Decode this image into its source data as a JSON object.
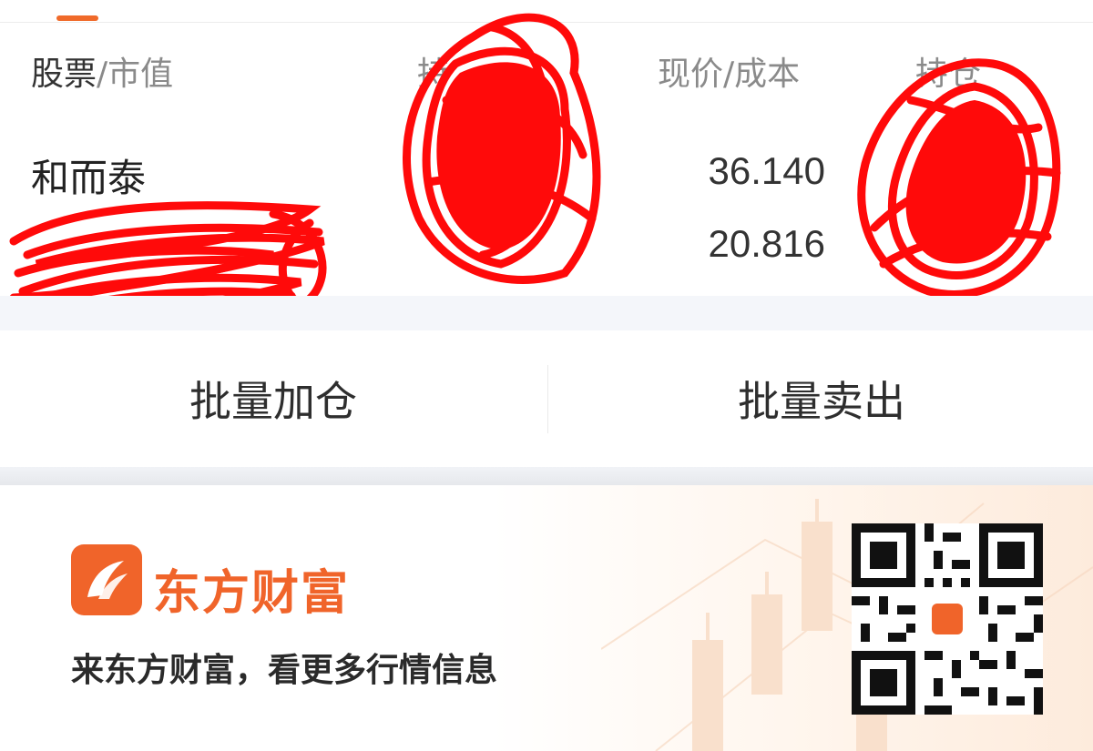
{
  "holdings": {
    "headers": {
      "stock": "股票",
      "market_value": "/市值",
      "holding_partial": "持",
      "price_cost": "现价/成本",
      "position_partial": "持仓"
    },
    "rows": [
      {
        "name": "和而泰",
        "price": "36.140",
        "cost": "20.816"
      }
    ]
  },
  "actions": {
    "add": "批量加仓",
    "sell": "批量卖出"
  },
  "banner": {
    "brand": "东方财富",
    "slogan": "来东方财富，看更多行情信息"
  },
  "colors": {
    "brand_orange": "#f0642a",
    "scribble_red": "#ff0a0a"
  }
}
